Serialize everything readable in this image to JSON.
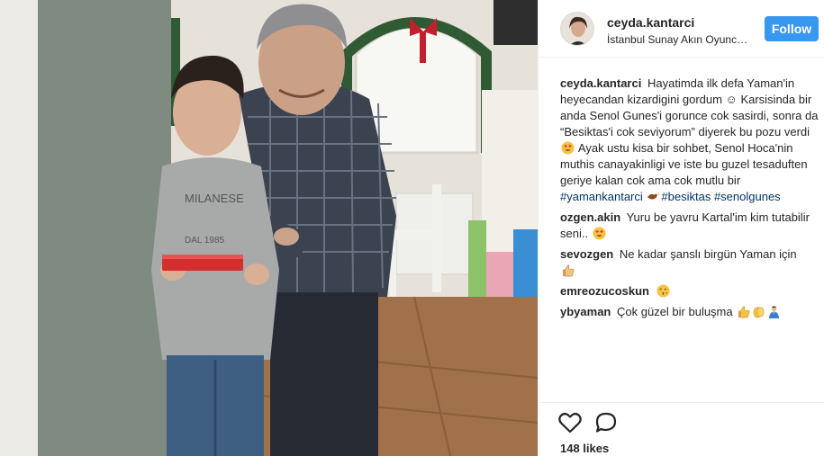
{
  "post": {
    "username": "ceyda.kantarci",
    "location": "İstanbul Sunay Akın Oyuncak Müzesi",
    "follow_label": "Follow",
    "likes": "148 likes"
  },
  "caption": {
    "user": "ceyda.kantarci",
    "text_1": "Hayatimda ilk defa Yaman'in heyecandan kizardigini gordum ☺ Karsisinda bir anda Senol Gunes'i gorunce cok sasirdi, sonra da “Besiktas'i cok seviyorum” diyerek bu pozu verdi",
    "text_2": "Ayak ustu kisa bir sohbet, Senol Hoca'nin muthis canayakinligi ve iste bu guzel tesaduften geriye kalan cok ama cok mutlu bir",
    "tag_1": "#yamankantarci",
    "tag_2": "#besiktas",
    "tag_3": "#senolgunes"
  },
  "comments": [
    {
      "user": "ozgen.akin",
      "text": "Yuru be yavru Kartal'im kim tutabilir seni.."
    },
    {
      "user": "sevozgen",
      "text": "Ne kadar şanslı birgün Yaman için"
    },
    {
      "user": "emreozucoskun",
      "text": ""
    },
    {
      "user": "ybyaman",
      "text": "Çok güzel bir buluşma"
    }
  ],
  "icons": {
    "like": "heart-outline-icon",
    "comment": "speech-bubble-icon",
    "heart_eyes": "heart-eyes-emoji",
    "eagle": "eagle-emoji",
    "thumbs_up": "thumbs-up-emoji",
    "clap": "clapping-hands-emoji",
    "pray": "praying-person-emoji",
    "kiss": "kissing-face-emoji"
  },
  "colors": {
    "follow_button": "#3897f0",
    "hashtag": "#003569",
    "text": "#262626",
    "divider": "#efefef"
  }
}
